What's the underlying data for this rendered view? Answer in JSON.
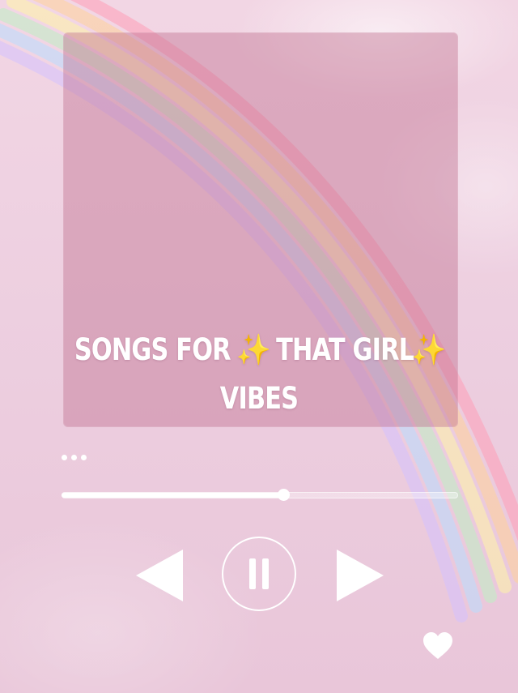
{
  "player": {
    "title_before": "SONGS FOR ",
    "sparkle_1": "✨",
    "title_middle": " THAT GIRL",
    "sparkle_2": "✨",
    "title_after": " VIBES",
    "progress": 0.56
  },
  "icons": {
    "more": "more-dots-icon",
    "previous": "previous-icon",
    "pause": "pause-icon",
    "next": "next-icon",
    "like": "heart-icon"
  },
  "colors": {
    "background": "#efd2e1",
    "cover": "#c98aa2",
    "controls": "#ffffff",
    "sparkle": "#f4c531"
  }
}
